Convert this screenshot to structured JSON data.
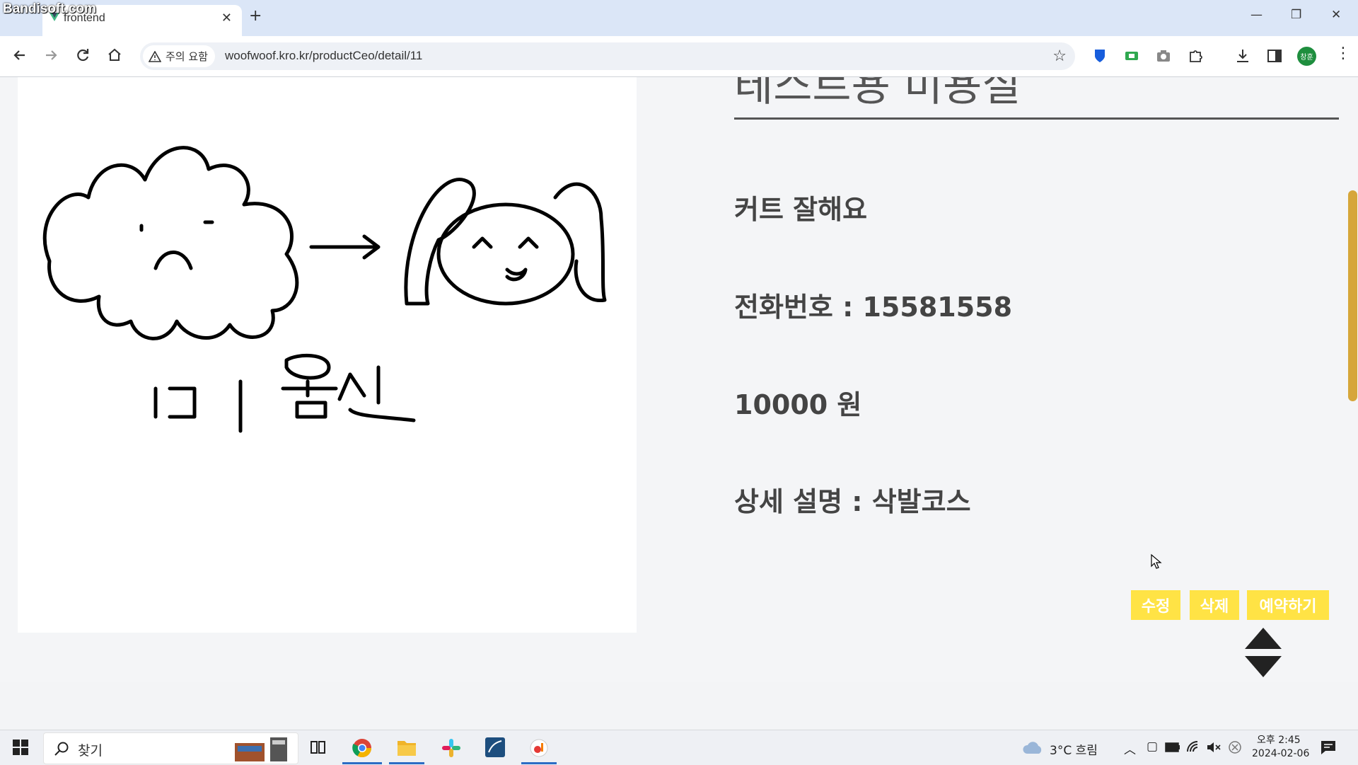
{
  "watermark": "Bandisoft.com",
  "browser": {
    "tab_title": "frontend",
    "tab_close": "✕",
    "new_tab": "+",
    "window_controls": {
      "minimize": "—",
      "restore": "❐",
      "close": "✕"
    },
    "security_label": "주의 요함",
    "url": "woofwoof.kro.kr/productCeo/detail/11",
    "profile_initials": "창훈"
  },
  "product": {
    "title": "테스트용 미용실",
    "headline": "커트 잘해요",
    "phone": "전화번호 : 15581558",
    "price": "10000 원",
    "description": "상세 설명 : 삭발코스"
  },
  "buttons": {
    "edit": "수정",
    "delete": "삭제",
    "reserve": "예약하기"
  },
  "taskbar": {
    "search_placeholder": "찾기",
    "weather": "3°C  흐림",
    "time": "오후 2:45",
    "date": "2024-02-06"
  },
  "colors": {
    "button_accent": "#ffe345",
    "scroll_thumb": "#d6a63a",
    "tab_strip": "#dbe6f7"
  }
}
